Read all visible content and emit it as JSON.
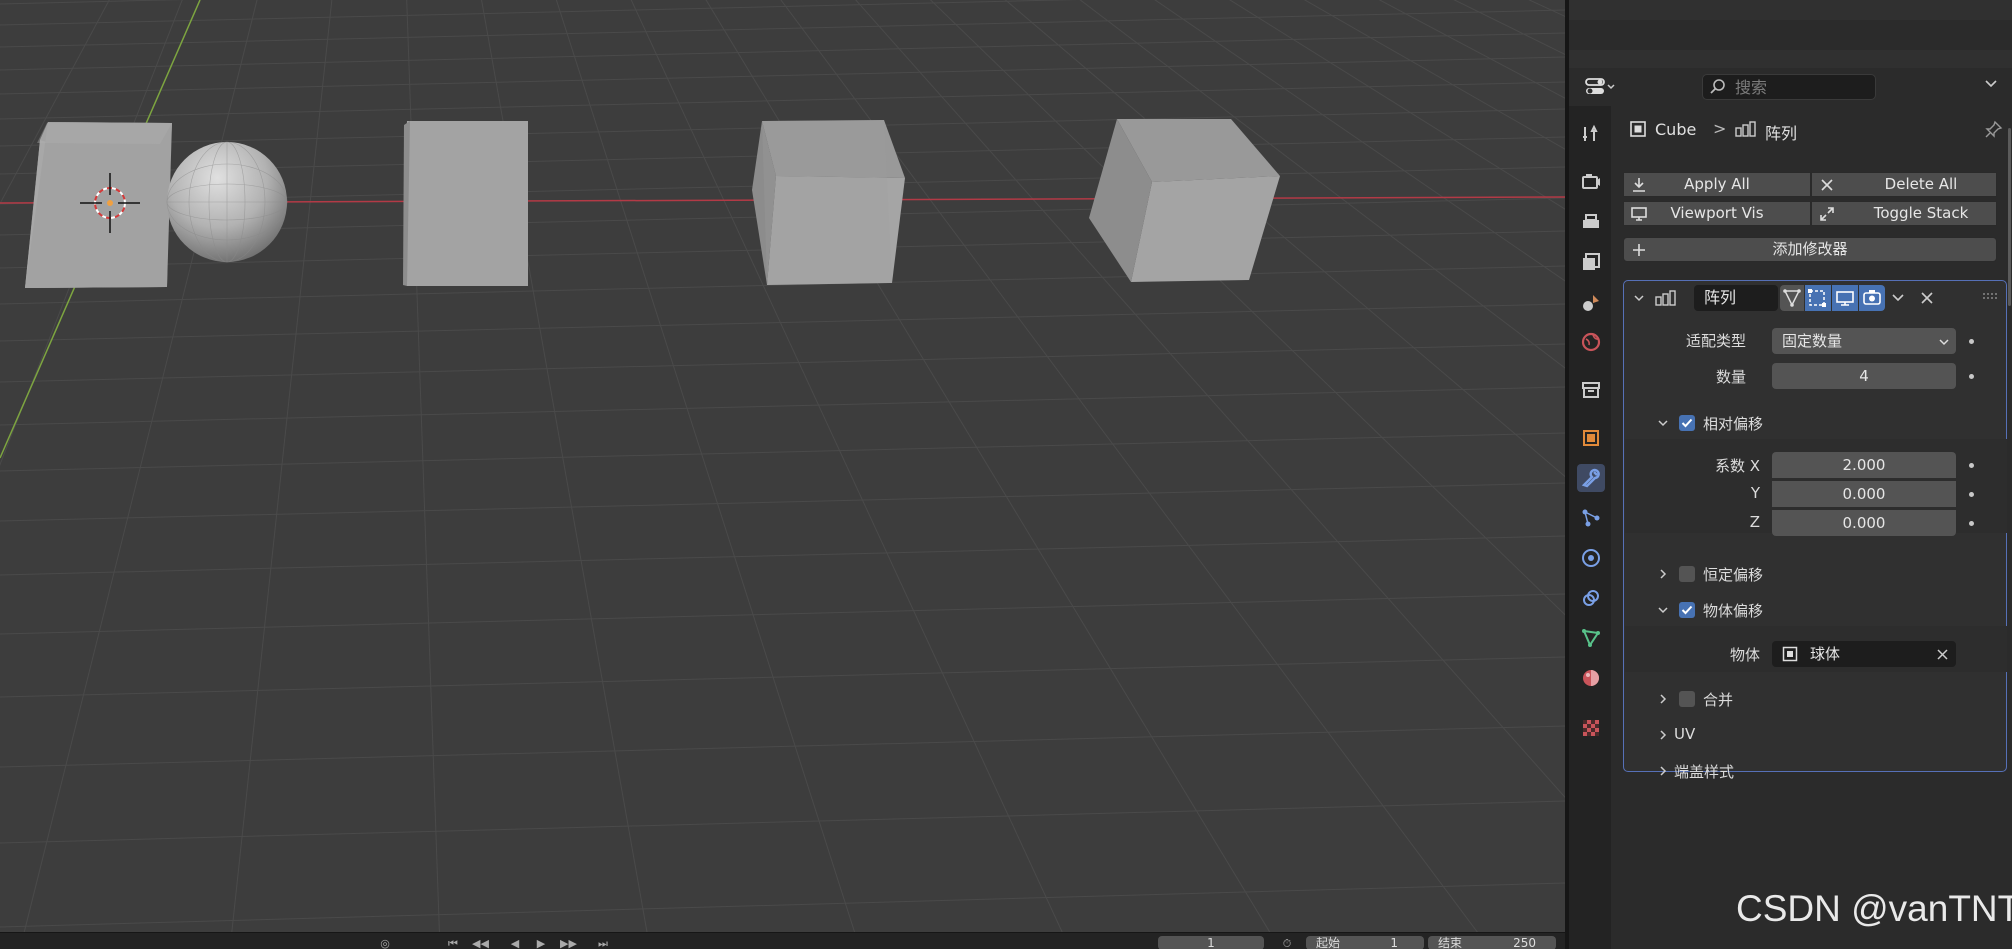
{
  "search": {
    "placeholder": "搜索"
  },
  "breadcrumb": {
    "object": "Cube",
    "separator": ">",
    "modifier": "阵列"
  },
  "stack_buttons": {
    "apply_all": "Apply All",
    "delete_all": "Delete All",
    "viewport_vis": "Viewport Vis",
    "toggle_stack": "Toggle Stack",
    "add_modifier": "添加修改器"
  },
  "modifier": {
    "name": "阵列",
    "fit_type": {
      "label": "适配类型",
      "value": "固定数量"
    },
    "count": {
      "label": "数量",
      "value": "4"
    },
    "relative_offset": {
      "label": "相对偏移",
      "enabled": true,
      "factor_x": {
        "label": "系数 X",
        "value": "2.000"
      },
      "factor_y": {
        "label": "Y",
        "value": "0.000"
      },
      "factor_z": {
        "label": "Z",
        "value": "0.000"
      }
    },
    "constant_offset": {
      "label": "恒定偏移",
      "enabled": false
    },
    "object_offset": {
      "label": "物体偏移",
      "enabled": true,
      "object": {
        "label": "物体",
        "value": "球体"
      }
    },
    "merge": {
      "label": "合并",
      "enabled": false
    },
    "uv": {
      "label": "UV"
    },
    "caps": {
      "label": "端盖样式"
    }
  },
  "timeline": {
    "frame_current": "1",
    "start_label": "起始",
    "start_value": "1",
    "end_label": "结束",
    "end_value": "250"
  },
  "watermark": "CSDN @vanTNT",
  "colors": {
    "viewport_bg": "#3d3d3d",
    "panel_bg": "#2b2b2b",
    "accent": "#4772b3",
    "x_axis": "#b33a46",
    "y_axis": "#7da540"
  }
}
